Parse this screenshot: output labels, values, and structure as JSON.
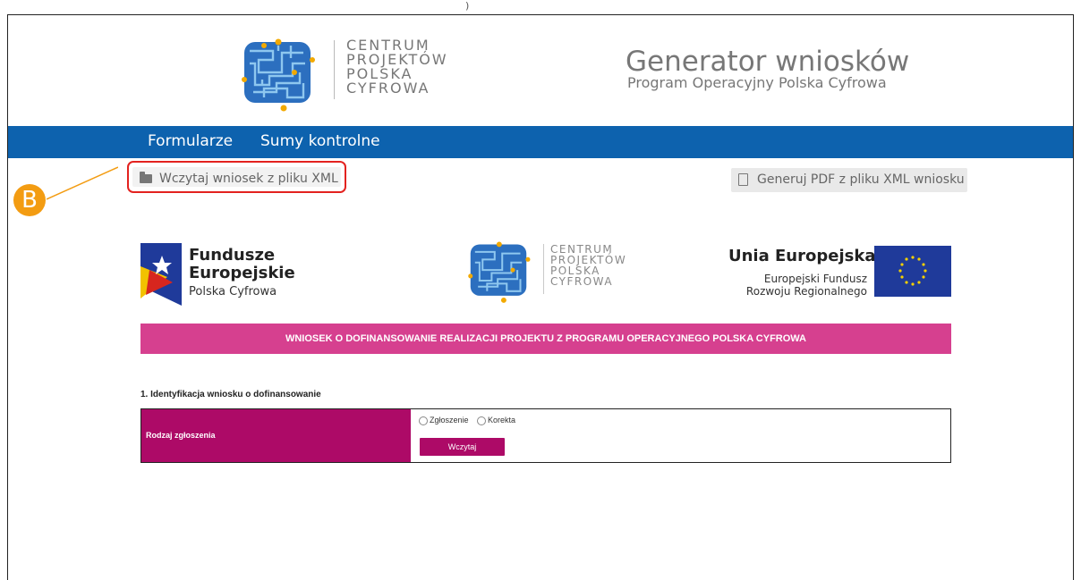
{
  "caption": ")",
  "header": {
    "logo_lines": [
      "CENTRUM",
      "PROJEKTÓW",
      "POLSKA",
      "CYFROWA"
    ],
    "title": "Generator wniosków",
    "subtitle": "Program Operacyjny Polska Cyfrowa"
  },
  "nav": {
    "items": [
      {
        "label": "Formularze"
      },
      {
        "label": "Sumy kontrolne"
      }
    ],
    "color": "#0d62ae"
  },
  "actions": {
    "load_xml_label": "Wczytaj wniosek z pliku XML",
    "pdf_label": "Generuj PDF z pliku XML wniosku",
    "highlight_color": "#e3221f"
  },
  "callout": {
    "label": "B",
    "color": "#f39c12"
  },
  "logos": {
    "fe_line1": "Fundusze",
    "fe_line2": "Europejskie",
    "fe_line3": "Polska Cyfrowa",
    "cpc_lines": [
      "CENTRUM",
      "PROJEKTÓW",
      "POLSKA",
      "CYFROWA"
    ],
    "ue_title": "Unia Europejska",
    "ue_line1": "Europejski Fundusz",
    "ue_line2": "Rozwoju Regionalnego"
  },
  "form": {
    "banner": "WNIOSEK O DOFINANSOWANIE REALIZACJI PROJEKTU Z PROGRAMU OPERACYJNEGO POLSKA CYFROWA",
    "section_title": "1. Identyfikacja wniosku o dofinansowanie",
    "row_label": "Rodzaj zgłoszenia",
    "options": [
      "Zgłoszenie",
      "Korekta"
    ],
    "submit_label": "Wczytaj",
    "accent": "#ad0a67",
    "banner_color": "#d6408f"
  }
}
